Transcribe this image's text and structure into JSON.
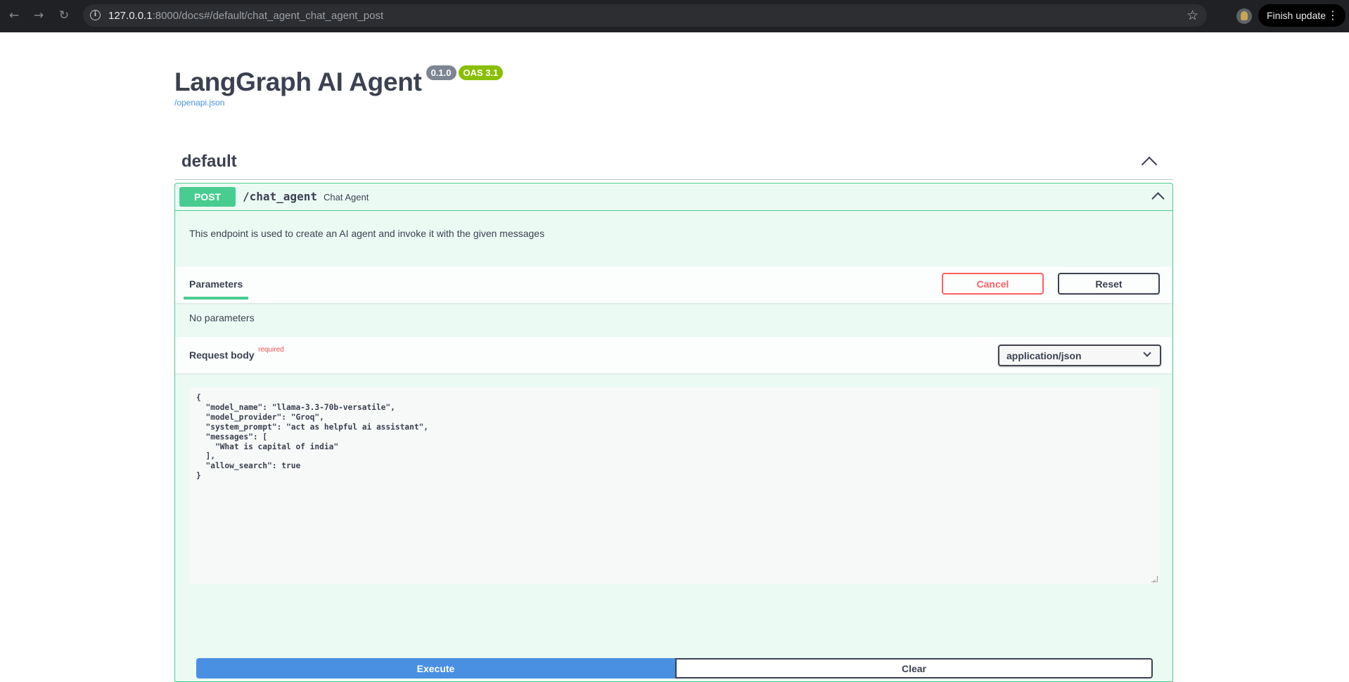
{
  "browser": {
    "url_host": "127.0.0.1",
    "url_rest": ":8000/docs#/default/chat_agent_chat_agent_post",
    "update_label": "Finish update",
    "icons": {
      "back": "arrow-left",
      "forward": "arrow-right",
      "reload": "reload",
      "site_info": "info",
      "bookmark": "star",
      "menu": "kebab"
    }
  },
  "header": {
    "title": "LangGraph AI Agent",
    "version": "0.1.0",
    "oas": "OAS 3.1",
    "spec_link": "/openapi.json"
  },
  "section": {
    "title": "default"
  },
  "operation": {
    "method": "POST",
    "path": "/chat_agent",
    "summary": "Chat Agent",
    "description": "This endpoint is used to create an AI agent and invoke it with the given messages",
    "parameters_tab": "Parameters",
    "cancel_label": "Cancel",
    "reset_label": "Reset",
    "no_parameters": "No parameters",
    "request_body_label": "Request body",
    "required_label": "required",
    "content_type": "application/json",
    "request_body": "{\n  \"model_name\": \"llama-3.3-70b-versatile\",\n  \"model_provider\": \"Groq\",\n  \"system_prompt\": \"act as helpful ai assistant\",\n  \"messages\": [\n    \"What is capital of india\"\n  ],\n  \"allow_search\": true\n}",
    "execute_label": "Execute",
    "clear_label": "Clear"
  },
  "colors": {
    "post_green": "#49cc90",
    "execute_blue": "#4990e2",
    "cancel_red": "#ff6060",
    "version_badge": "#7d8492",
    "oas_badge": "#89bf04"
  }
}
